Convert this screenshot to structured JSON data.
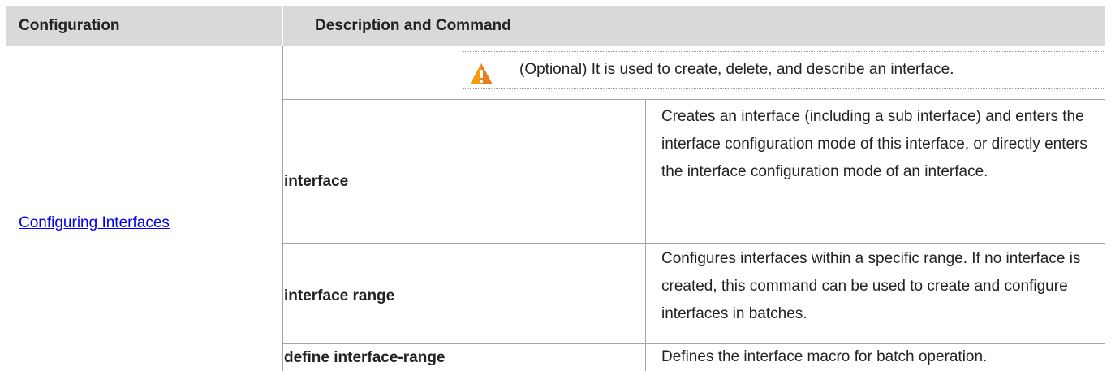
{
  "table": {
    "headers": {
      "configuration": "Configuration",
      "description_and_command": "Description and Command"
    },
    "configuration_link": "Configuring Interfaces",
    "note": {
      "icon": "warning-icon",
      "text": "(Optional) It is used to create, delete, and describe an interface."
    },
    "rows": [
      {
        "command": "interface",
        "description": "Creates an interface (including a sub interface) and enters the interface configuration mode of this interface, or directly enters the interface configuration mode of an interface."
      },
      {
        "command": "interface range",
        "description": "Configures interfaces within a specific range. If no interface is created, this command can be used to create and configure interfaces in batches."
      },
      {
        "command": "define interface-range",
        "description": "Defines the interface macro for batch operation."
      }
    ]
  },
  "colors": {
    "header_bg": "#d9d9d9",
    "link": "#0000ee",
    "warning": "#f39c12"
  }
}
